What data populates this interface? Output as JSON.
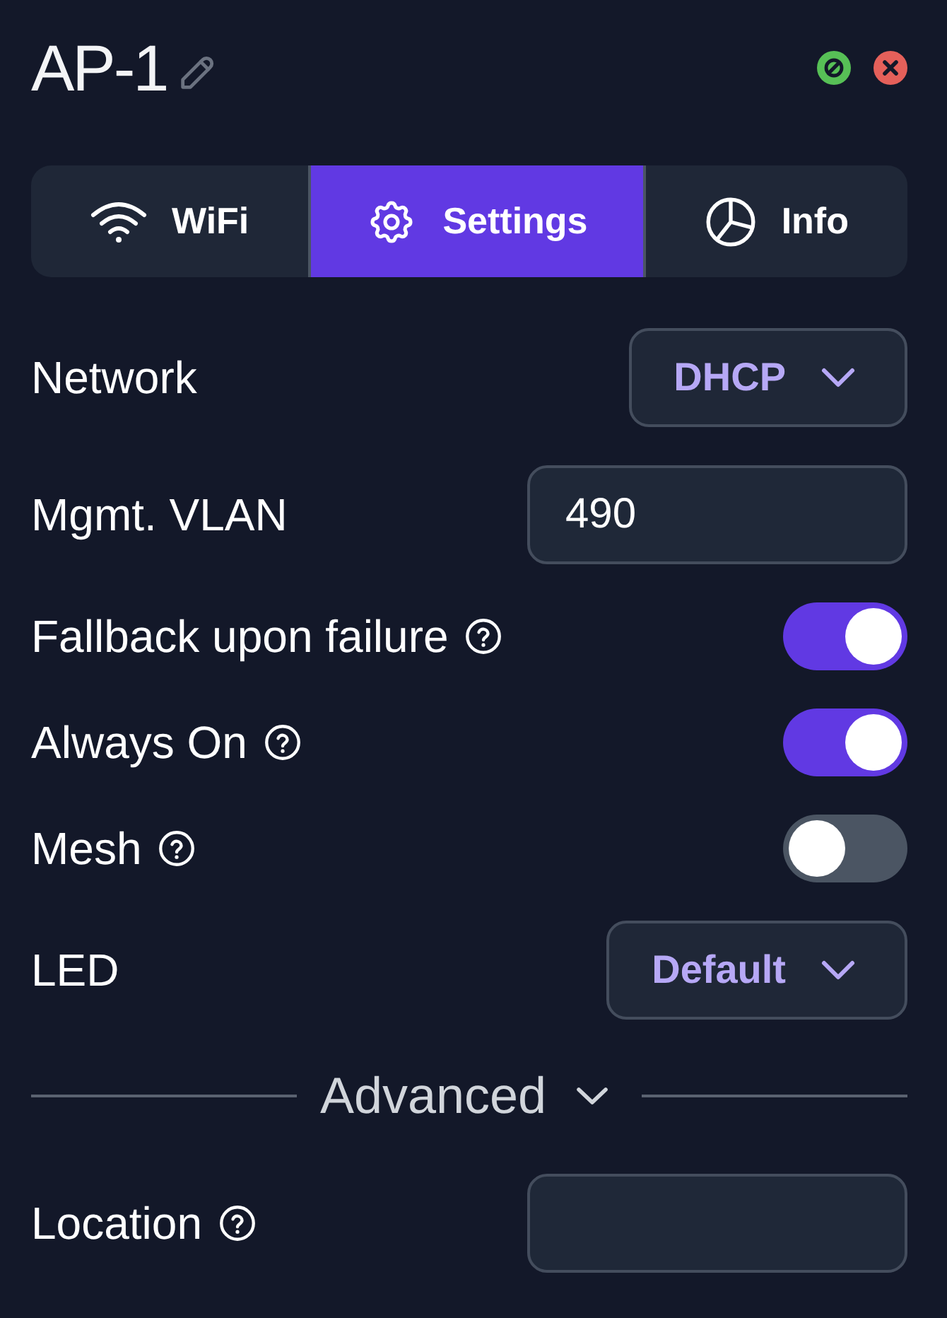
{
  "header": {
    "title": "AP-1"
  },
  "tabs": [
    {
      "label": "WiFi",
      "selected": false
    },
    {
      "label": "Settings",
      "selected": true
    },
    {
      "label": "Info",
      "selected": false
    }
  ],
  "settings": [
    {
      "label": "Network",
      "kind": "select",
      "help": false,
      "value": "DHCP"
    },
    {
      "label": "Mgmt. VLAN",
      "kind": "input",
      "help": false,
      "value": "490"
    },
    {
      "label": "Fallback upon failure",
      "kind": "toggle",
      "help": true,
      "on": true
    },
    {
      "label": "Always On",
      "kind": "toggle",
      "help": true,
      "on": true
    },
    {
      "label": "Mesh",
      "kind": "toggle",
      "help": true,
      "on": false
    },
    {
      "label": "LED",
      "kind": "select",
      "help": false,
      "value": "Default"
    }
  ],
  "advanced": {
    "label": "Advanced"
  },
  "advanced_settings": [
    {
      "label": "Location",
      "kind": "input",
      "help": true
    }
  ]
}
